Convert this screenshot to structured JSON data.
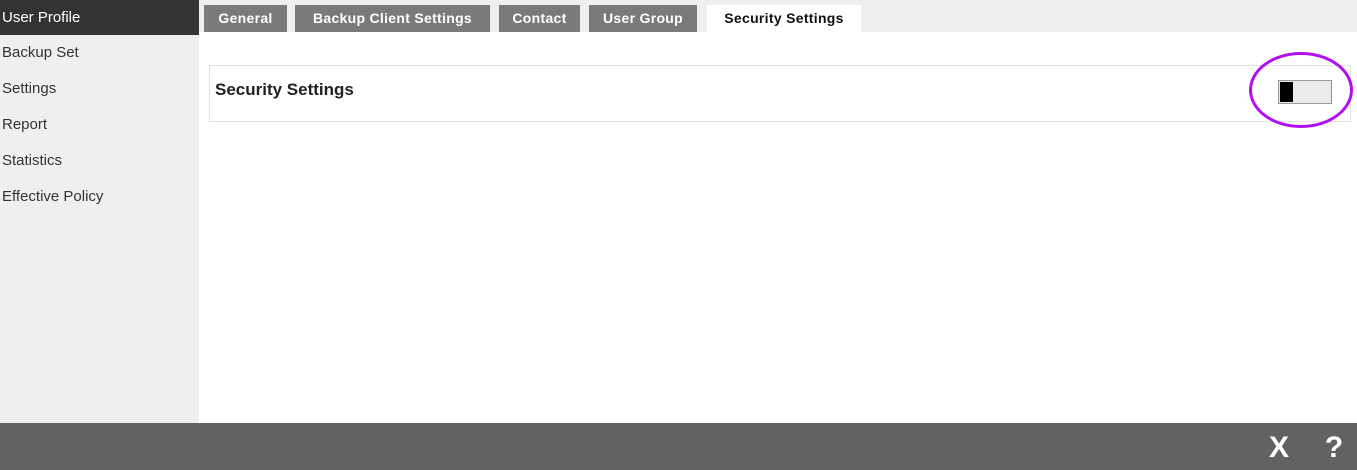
{
  "sidebar": {
    "items": [
      {
        "label": "User Profile",
        "active": true
      },
      {
        "label": "Backup Set"
      },
      {
        "label": "Settings"
      },
      {
        "label": "Report"
      },
      {
        "label": "Statistics"
      },
      {
        "label": "Effective Policy"
      }
    ]
  },
  "tabs": [
    {
      "label": "General"
    },
    {
      "label": "Backup Client Settings"
    },
    {
      "label": "Contact"
    },
    {
      "label": "User Group"
    },
    {
      "label": "Security Settings",
      "active": true
    }
  ],
  "panel": {
    "title": "Security Settings",
    "toggle_enabled": false
  },
  "footer": {
    "close_label": "X",
    "help_label": "?"
  },
  "colors": {
    "sidebar_active_bg": "#333333",
    "tab_bg": "#7a7a7a",
    "footer_bg": "#616261",
    "highlight_ring": "#b30ef0"
  }
}
